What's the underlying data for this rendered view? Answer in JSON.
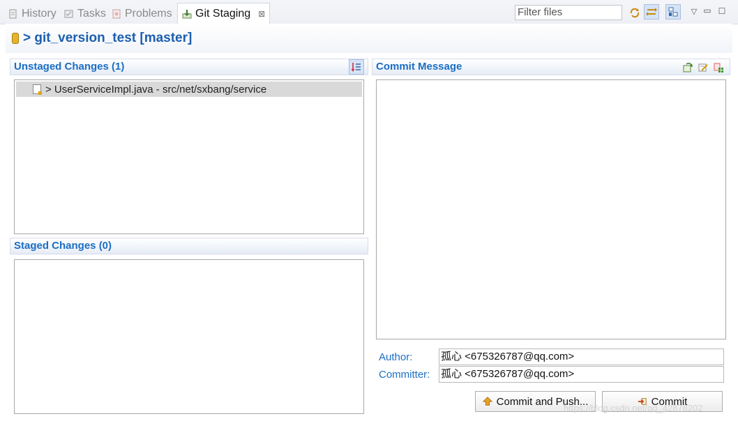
{
  "tabs": [
    {
      "label": "History",
      "icon": "history-icon"
    },
    {
      "label": "Tasks",
      "icon": "tasks-icon"
    },
    {
      "label": "Problems",
      "icon": "problems-icon"
    },
    {
      "label": "Git Staging",
      "icon": "git-staging-icon",
      "active": true
    }
  ],
  "filter": {
    "placeholder": "Filter files"
  },
  "repo": {
    "title": "> git_version_test [master]"
  },
  "unstaged": {
    "header": "Unstaged Changes (1)",
    "items": [
      {
        "label": "> UserServiceImpl.java - src/net/sxbang/service"
      }
    ]
  },
  "staged": {
    "header": "Staged Changes (0)"
  },
  "commit": {
    "header": "Commit Message",
    "message": "",
    "author_label": "Author:",
    "author_value": "孤心 <675326787@qq.com>",
    "committer_label": "Committer:",
    "committer_value": "孤心 <675326787@qq.com>",
    "commit_push_label": "Commit and Push...",
    "commit_label": "Commit"
  },
  "watermark": "https://blog.csdn.net/qq_42878202",
  "colors": {
    "accent": "#1a6ec4",
    "selection": "#d9d9d9",
    "border": "#a7a7a7"
  }
}
